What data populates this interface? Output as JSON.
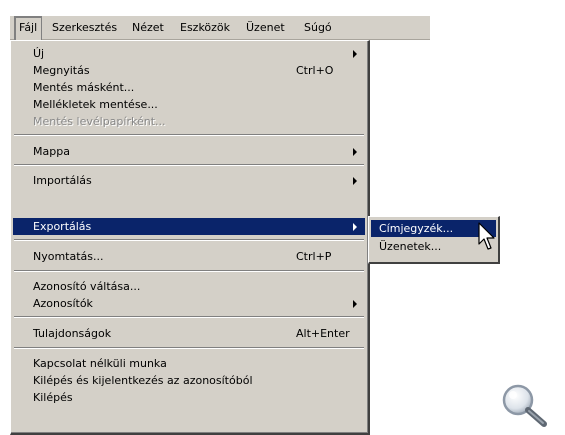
{
  "menubar": {
    "items": [
      "Fájl",
      "Szerkesztés",
      "Nézet",
      "Eszközök",
      "Üzenet",
      "Súgó"
    ]
  },
  "file_menu": {
    "items": [
      {
        "label": "Új",
        "shortcut": "",
        "submenu": true
      },
      {
        "label": "Megnyitás",
        "shortcut": "Ctrl+O",
        "submenu": false
      },
      {
        "label": "Mentés másként...",
        "shortcut": "",
        "submenu": false
      },
      {
        "label": "Mellékletek mentése...",
        "shortcut": "",
        "submenu": false
      },
      {
        "label": "Mentés levélpapírként...",
        "shortcut": "",
        "submenu": false,
        "disabled": true
      },
      {
        "label": "Mappa",
        "shortcut": "",
        "submenu": true
      },
      {
        "label": "Importálás",
        "shortcut": "",
        "submenu": true
      },
      {
        "label": "Exportálás",
        "shortcut": "",
        "submenu": true,
        "highlighted": true
      },
      {
        "label": "Nyomtatás...",
        "shortcut": "Ctrl+P",
        "submenu": false
      },
      {
        "label": "Azonosító váltása...",
        "shortcut": "",
        "submenu": false
      },
      {
        "label": "Azonosítók",
        "shortcut": "",
        "submenu": true
      },
      {
        "label": "Tulajdonságok",
        "shortcut": "Alt+Enter",
        "submenu": false
      },
      {
        "label": "Kapcsolat nélküli munka",
        "shortcut": "",
        "submenu": false
      },
      {
        "label": "Kilépés és kijelentkezés az azonosítóból",
        "shortcut": "",
        "submenu": false
      },
      {
        "label": "Kilépés",
        "shortcut": "",
        "submenu": false
      }
    ]
  },
  "export_submenu": {
    "items": [
      {
        "label": "Címjegyzék...",
        "highlighted": true
      },
      {
        "label": "Üzenetek..."
      }
    ]
  },
  "colors": {
    "menu_bg": "#d4d0c8",
    "highlight": "#0a246a",
    "disabled_text": "#888888"
  },
  "icons": [
    "arrow-cursor-icon",
    "magnifier-icon"
  ]
}
